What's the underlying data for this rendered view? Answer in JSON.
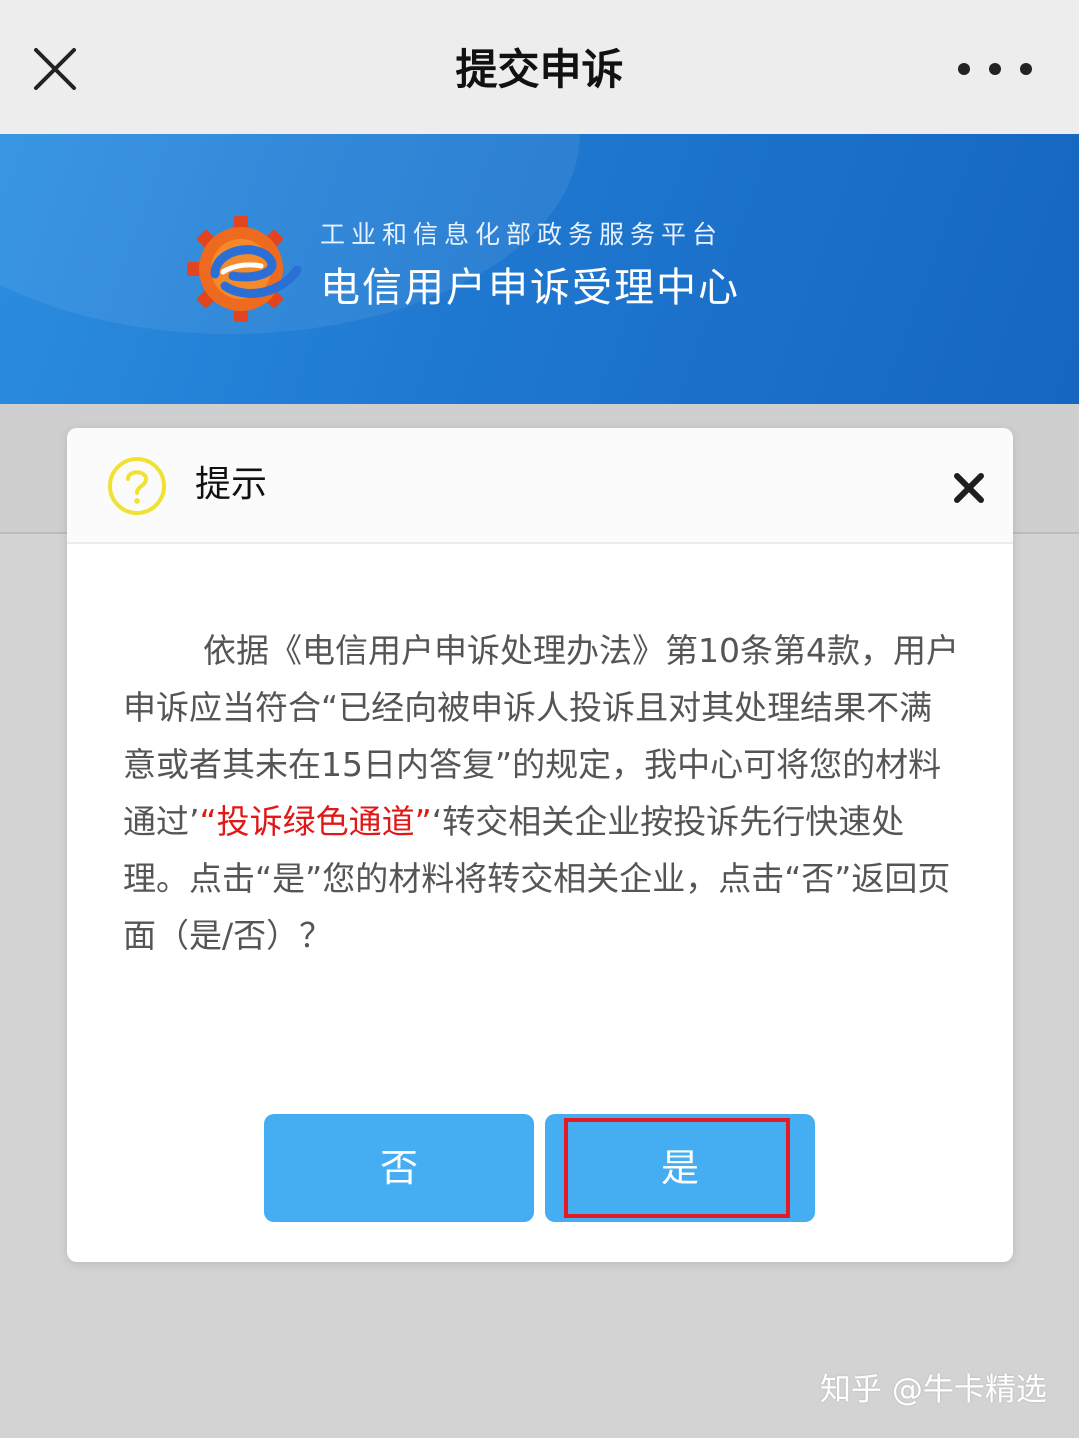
{
  "topbar": {
    "title": "提交申诉",
    "close_icon": "close-icon",
    "more_icon": "more-dots-icon"
  },
  "banner": {
    "logo_icon": "gear-e-logo",
    "org": "工业和信息化部政务服务平台",
    "center_name": "电信用户申诉受理中心",
    "color": "#1f78d0"
  },
  "dialog": {
    "icon": "question-circle-icon",
    "title": "提示",
    "close_icon": "close-x-icon",
    "message_part1": "依据《电信用户申诉处理办法》第10条第4款，用户申诉应当符合“已经向被申诉人投诉且对其处理结果不满意或者其未在15日内答复”的规定，我中心可将您的材料通过’",
    "message_highlight": "“投诉绿色通道”",
    "message_part2": "‘转交相关企业按投诉先行快速处理。点击“是”您的材料将转交相关企业，点击“否”返回页面（是/否）？",
    "highlight_color": "#e01818",
    "button_no": "否",
    "button_yes": "是",
    "button_color": "#45aef2"
  },
  "watermark": "知乎 @牛卡精选"
}
